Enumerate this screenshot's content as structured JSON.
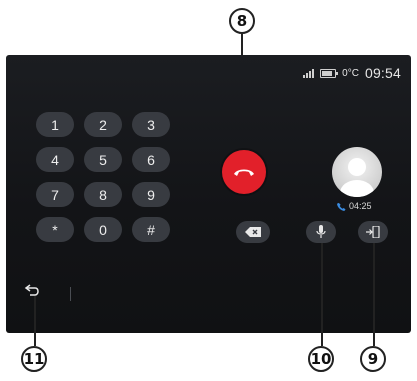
{
  "callouts": {
    "end_call": "8",
    "transfer": "9",
    "mute": "10",
    "back": "11"
  },
  "status_bar": {
    "temperature": "0°C",
    "time": "09:54"
  },
  "keypad": {
    "keys": [
      "1",
      "2",
      "3",
      "4",
      "5",
      "6",
      "7",
      "8",
      "9",
      "*",
      "0",
      "#"
    ]
  },
  "call": {
    "duration": "04:25"
  },
  "colors": {
    "end_call": "#e2202a",
    "accent": "#3a8be0",
    "screen_bg": "#16171a",
    "key_bg": "#383b41"
  },
  "icons": {
    "end_call": "phone-hangup-icon",
    "backspace": "backspace-icon",
    "mute": "microphone-icon",
    "transfer": "transfer-to-handset-icon",
    "back": "back-arrow-icon",
    "duration": "phone-icon",
    "avatar": "contact-silhouette-icon"
  }
}
